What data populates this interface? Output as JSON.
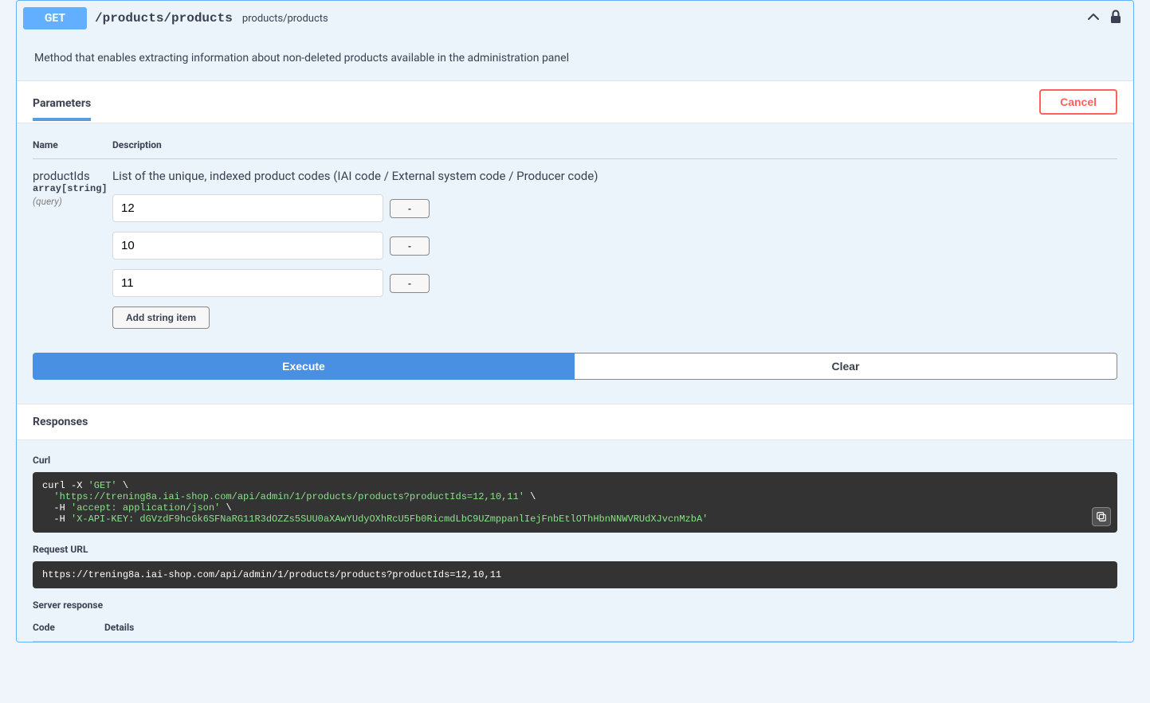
{
  "operation": {
    "method": "GET",
    "path": "/products/products",
    "summary": "products/products",
    "description": "Method that enables extracting information about non-deleted products available in the administration panel"
  },
  "sections": {
    "parameters_title": "Parameters",
    "cancel_label": "Cancel",
    "responses_title": "Responses"
  },
  "table_headers": {
    "name": "Name",
    "description": "Description",
    "code": "Code",
    "details": "Details"
  },
  "parameter": {
    "name": "productIds",
    "type": "array[string]",
    "in": "(query)",
    "description": "List of the unique, indexed product codes (IAI code / External system code / Producer code)",
    "values": [
      "12",
      "10",
      "11"
    ],
    "remove_label": "-",
    "add_label": "Add string item"
  },
  "buttons": {
    "execute": "Execute",
    "clear": "Clear"
  },
  "curl": {
    "label": "Curl",
    "line1a": "curl -X ",
    "line1b": "'GET'",
    "line1c": " \\",
    "line2a": "  ",
    "line2b": "'https://trening8a.iai-shop.com/api/admin/1/products/products?productIds=12,10,11'",
    "line2c": " \\",
    "line3a": "  -H ",
    "line3b": "'accept: application/json'",
    "line3c": " \\",
    "line4a": "  -H ",
    "line4b": "'X-API-KEY: dGVzdF9hcGk6SFNaRG11R3dOZZs5SUU0aXAwYUdyOXhRcU5Fb0RicmdLbC9UZmppanlIejFnbEtlOThHbnNNWVRUdXJvcnMzbA'"
  },
  "request_url": {
    "label": "Request URL",
    "value": "https://trening8a.iai-shop.com/api/admin/1/products/products?productIds=12,10,11"
  },
  "server_response_label": "Server response"
}
